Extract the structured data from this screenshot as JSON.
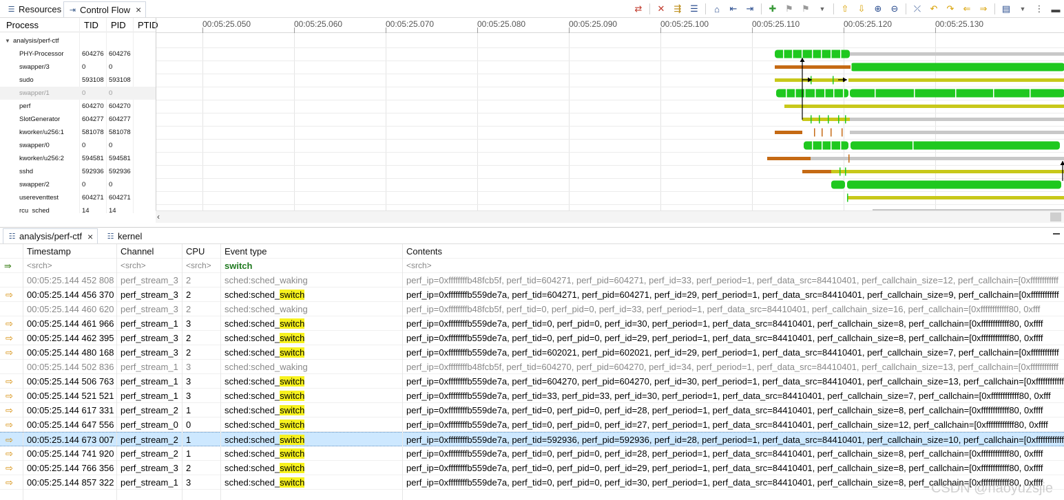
{
  "top_tabs": [
    {
      "label": "Resources",
      "icon": "resources-icon"
    },
    {
      "label": "Control Flow",
      "icon": "control-flow-icon"
    }
  ],
  "proc_columns": [
    "Process",
    "TID",
    "PID",
    "PTID"
  ],
  "trace_root": "analysis/perf-ctf",
  "processes": [
    {
      "name": "PHY-Processor",
      "tid": "604276",
      "pid": "604276",
      "dim": false
    },
    {
      "name": "swapper/3",
      "tid": "0",
      "pid": "0",
      "dim": false
    },
    {
      "name": "sudo",
      "tid": "593108",
      "pid": "593108",
      "dim": false
    },
    {
      "name": "swapper/1",
      "tid": "0",
      "pid": "0",
      "dim": true
    },
    {
      "name": "perf",
      "tid": "604270",
      "pid": "604270",
      "dim": false
    },
    {
      "name": "SlotGenerator",
      "tid": "604277",
      "pid": "604277",
      "dim": false
    },
    {
      "name": "kworker/u256:1",
      "tid": "581078",
      "pid": "581078",
      "dim": false
    },
    {
      "name": "swapper/0",
      "tid": "0",
      "pid": "0",
      "dim": false
    },
    {
      "name": "kworker/u256:2",
      "tid": "594581",
      "pid": "594581",
      "dim": false
    },
    {
      "name": "sshd",
      "tid": "592936",
      "pid": "592936",
      "dim": false
    },
    {
      "name": "swapper/2",
      "tid": "0",
      "pid": "0",
      "dim": false
    },
    {
      "name": "usereventtest",
      "tid": "604271",
      "pid": "604271",
      "dim": false
    },
    {
      "name": "rcu_sched",
      "tid": "14",
      "pid": "14",
      "dim": false
    }
  ],
  "time_ticks": [
    "00:05:25.050",
    "00:05:25.060",
    "00:05:25.070",
    "00:05:25.080",
    "00:05:25.090",
    "00:05:25.100",
    "00:05:25.110",
    "00:05:25.120",
    "00:05:25.130"
  ],
  "colors": {
    "running": "#1fc81f",
    "waiting": "#c8c81a",
    "blocked": "#c56a14",
    "idle": "#c8c8c8",
    "selected_row": "#cde8ff",
    "highlight": "#f7f21e",
    "filter_text": "#1f7a1f"
  },
  "bottom_tabs": [
    {
      "label": "analysis/perf-ctf",
      "icon": "events-table-icon"
    },
    {
      "label": "kernel",
      "icon": "events-table-icon"
    }
  ],
  "table_columns": [
    "Timestamp",
    "Channel",
    "CPU",
    "Event type",
    "Contents"
  ],
  "search_row": {
    "timestamp": "<srch>",
    "channel": "<srch>",
    "cpu": "<srch>",
    "event_type": "switch",
    "contents": "<srch>"
  },
  "events": [
    {
      "ts": "00:05:25.144 452 808",
      "channel": "perf_stream_3",
      "cpu": "2",
      "type_pre": "sched:sched_waking",
      "type_hl": "",
      "contents": "perf_ip=0xffffffffb48fcb5f, perf_tid=604271, perf_pid=604271, perf_id=33, perf_period=1, perf_data_src=84410401, perf_callchain_size=12, perf_callchain=[0xffffffffffff",
      "match": false,
      "selected": false
    },
    {
      "ts": "00:05:25.144 456 370",
      "channel": "perf_stream_3",
      "cpu": "2",
      "type_pre": "sched:sched_",
      "type_hl": "switch",
      "contents": "perf_ip=0xffffffffb559de7a, perf_tid=604271, perf_pid=604271, perf_id=29, perf_period=1, perf_data_src=84410401, perf_callchain_size=9, perf_callchain=[0xffffffffffff",
      "match": true,
      "selected": false
    },
    {
      "ts": "00:05:25.144 460 620",
      "channel": "perf_stream_3",
      "cpu": "2",
      "type_pre": "sched:sched_waking",
      "type_hl": "",
      "contents": "perf_ip=0xffffffffb48fcb5f, perf_tid=0, perf_pid=0, perf_id=33, perf_period=1, perf_data_src=84410401, perf_callchain_size=16, perf_callchain=[0xffffffffffff80, 0xfff",
      "match": false,
      "selected": false
    },
    {
      "ts": "00:05:25.144 461 966",
      "channel": "perf_stream_1",
      "cpu": "3",
      "type_pre": "sched:sched_",
      "type_hl": "switch",
      "contents": "perf_ip=0xffffffffb559de7a, perf_tid=0, perf_pid=0, perf_id=30, perf_period=1, perf_data_src=84410401, perf_callchain_size=8, perf_callchain=[0xffffffffffff80, 0xffff",
      "match": true,
      "selected": false
    },
    {
      "ts": "00:05:25.144 462 395",
      "channel": "perf_stream_3",
      "cpu": "2",
      "type_pre": "sched:sched_",
      "type_hl": "switch",
      "contents": "perf_ip=0xffffffffb559de7a, perf_tid=0, perf_pid=0, perf_id=29, perf_period=1, perf_data_src=84410401, perf_callchain_size=8, perf_callchain=[0xffffffffffff80, 0xffff",
      "match": true,
      "selected": false
    },
    {
      "ts": "00:05:25.144 480 168",
      "channel": "perf_stream_3",
      "cpu": "2",
      "type_pre": "sched:sched_",
      "type_hl": "switch",
      "contents": "perf_ip=0xffffffffb559de7a, perf_tid=602021, perf_pid=602021, perf_id=29, perf_period=1, perf_data_src=84410401, perf_callchain_size=7, perf_callchain=[0xffffffffffff",
      "match": true,
      "selected": false
    },
    {
      "ts": "00:05:25.144 502 836",
      "channel": "perf_stream_1",
      "cpu": "3",
      "type_pre": "sched:sched_waking",
      "type_hl": "",
      "contents": "perf_ip=0xffffffffb48fcb5f, perf_tid=604270, perf_pid=604270, perf_id=34, perf_period=1, perf_data_src=84410401, perf_callchain_size=13, perf_callchain=[0xffffffffffff",
      "match": false,
      "selected": false
    },
    {
      "ts": "00:05:25.144 506 763",
      "channel": "perf_stream_1",
      "cpu": "3",
      "type_pre": "sched:sched_",
      "type_hl": "switch",
      "contents": "perf_ip=0xffffffffb559de7a, perf_tid=604270, perf_pid=604270, perf_id=30, perf_period=1, perf_data_src=84410401, perf_callchain_size=13, perf_callchain=[0xffffffffffff",
      "match": true,
      "selected": false
    },
    {
      "ts": "00:05:25.144 521 521",
      "channel": "perf_stream_1",
      "cpu": "3",
      "type_pre": "sched:sched_",
      "type_hl": "switch",
      "contents": "perf_ip=0xffffffffb559de7a, perf_tid=33, perf_pid=33, perf_id=30, perf_period=1, perf_data_src=84410401, perf_callchain_size=7, perf_callchain=[0xffffffffffff80, 0xfff",
      "match": true,
      "selected": false
    },
    {
      "ts": "00:05:25.144 617 331",
      "channel": "perf_stream_2",
      "cpu": "1",
      "type_pre": "sched:sched_",
      "type_hl": "switch",
      "contents": "perf_ip=0xffffffffb559de7a, perf_tid=0, perf_pid=0, perf_id=28, perf_period=1, perf_data_src=84410401, perf_callchain_size=8, perf_callchain=[0xffffffffffff80, 0xffff",
      "match": true,
      "selected": false
    },
    {
      "ts": "00:05:25.144 647 556",
      "channel": "perf_stream_0",
      "cpu": "0",
      "type_pre": "sched:sched_",
      "type_hl": "switch",
      "contents": "perf_ip=0xffffffffb559de7a, perf_tid=0, perf_pid=0, perf_id=27, perf_period=1, perf_data_src=84410401, perf_callchain_size=12, perf_callchain=[0xffffffffffff80, 0xffff",
      "match": true,
      "selected": false
    },
    {
      "ts": "00:05:25.144 673 007",
      "channel": "perf_stream_2",
      "cpu": "1",
      "type_pre": "sched:sched_",
      "type_hl": "switch",
      "contents": "perf_ip=0xffffffffb559de7a, perf_tid=592936, perf_pid=592936, perf_id=28, perf_period=1, perf_data_src=84410401, perf_callchain_size=10, perf_callchain=[0xffffffffffff",
      "match": true,
      "selected": true
    },
    {
      "ts": "00:05:25.144 741 920",
      "channel": "perf_stream_2",
      "cpu": "1",
      "type_pre": "sched:sched_",
      "type_hl": "switch",
      "contents": "perf_ip=0xffffffffb559de7a, perf_tid=0, perf_pid=0, perf_id=28, perf_period=1, perf_data_src=84410401, perf_callchain_size=8, perf_callchain=[0xffffffffffff80, 0xffff",
      "match": true,
      "selected": false
    },
    {
      "ts": "00:05:25.144 766 356",
      "channel": "perf_stream_3",
      "cpu": "2",
      "type_pre": "sched:sched_",
      "type_hl": "switch",
      "contents": "perf_ip=0xffffffffb559de7a, perf_tid=0, perf_pid=0, perf_id=29, perf_period=1, perf_data_src=84410401, perf_callchain_size=8, perf_callchain=[0xffffffffffff80, 0xffff",
      "match": true,
      "selected": false
    },
    {
      "ts": "00:05:25.144 857 322",
      "channel": "perf_stream_1",
      "cpu": "3",
      "type_pre": "sched:sched_",
      "type_hl": "switch",
      "contents": "perf_ip=0xffffffffb559de7a, perf_tid=0, perf_pid=0, perf_id=30, perf_period=1, perf_data_src=84410401, perf_callchain_size=8, perf_callchain=[0xffffffffffff80, 0xffff",
      "match": true,
      "selected": false
    }
  ],
  "watermark": "CSDN @haoyuzsjie"
}
